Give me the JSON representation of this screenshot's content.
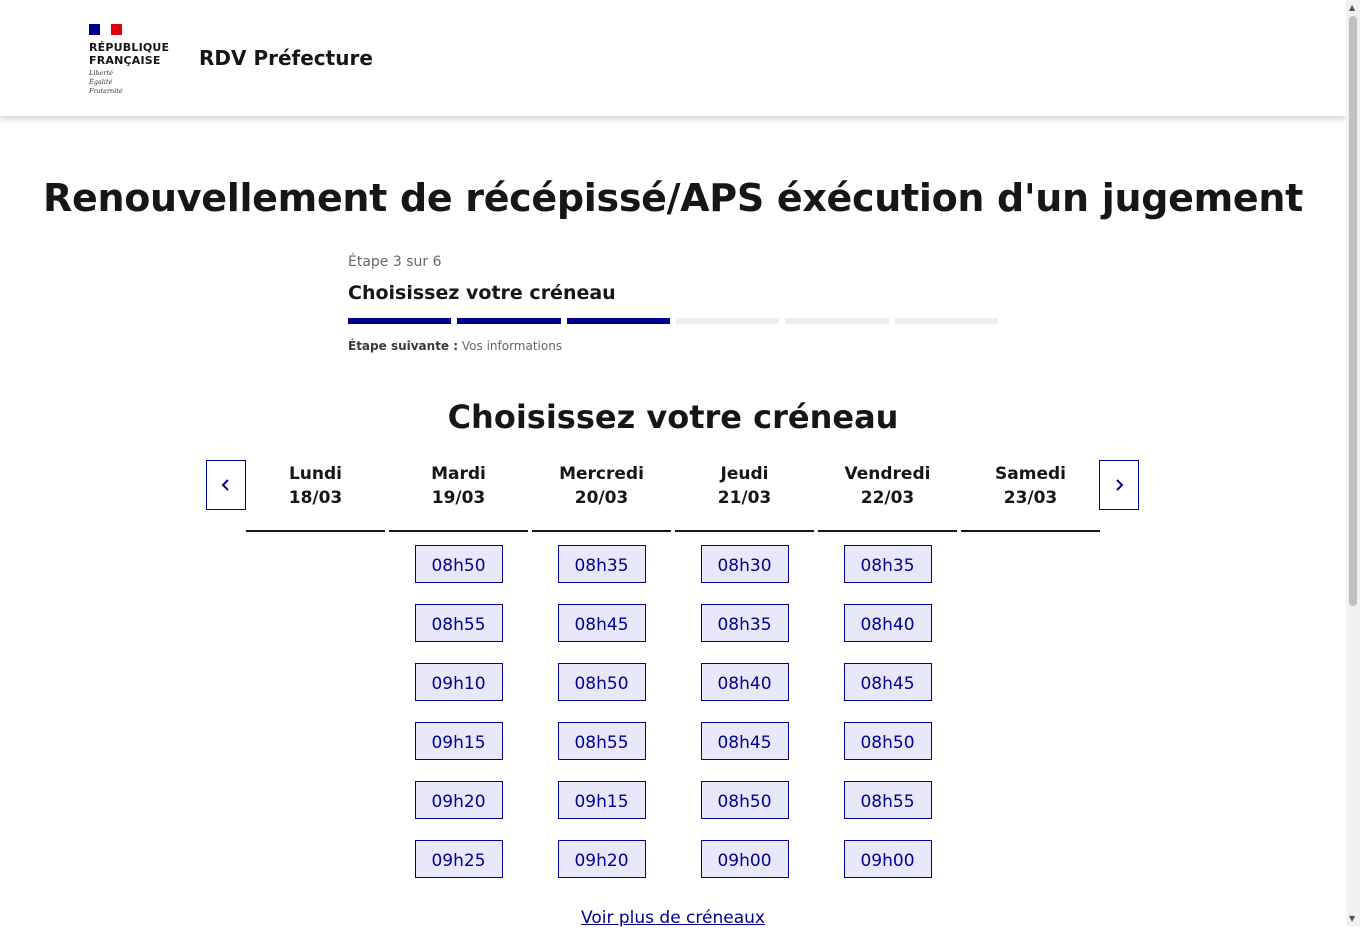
{
  "header": {
    "logo_text": "RÉPUBLIQUE\nFRANÇAISE",
    "logo_motto": "Liberté\nÉgalité\nFraternité",
    "flag_colors": [
      "#000091",
      "#ffffff",
      "#e1000f"
    ],
    "service_title": "RDV Préfecture"
  },
  "page": {
    "title": "Renouvellement de récépissé/APS éxécution d'un jugement"
  },
  "stepper": {
    "count": "Étape 3 sur 6",
    "title": "Choisissez votre créneau",
    "total_steps": 6,
    "completed_steps": 3,
    "next_label": "Étape suivante :",
    "next_value": "Vos informations"
  },
  "calendar": {
    "title": "Choisissez votre créneau",
    "prev_icon": "chevron-left-icon",
    "next_icon": "chevron-right-icon",
    "days": [
      {
        "name": "Lundi",
        "date": "18/03",
        "slots": []
      },
      {
        "name": "Mardi",
        "date": "19/03",
        "slots": [
          "08h50",
          "08h55",
          "09h10",
          "09h15",
          "09h20",
          "09h25"
        ]
      },
      {
        "name": "Mercredi",
        "date": "20/03",
        "slots": [
          "08h35",
          "08h45",
          "08h50",
          "08h55",
          "09h15",
          "09h20"
        ]
      },
      {
        "name": "Jeudi",
        "date": "21/03",
        "slots": [
          "08h30",
          "08h35",
          "08h40",
          "08h45",
          "08h50",
          "09h00"
        ]
      },
      {
        "name": "Vendredi",
        "date": "22/03",
        "slots": [
          "08h35",
          "08h40",
          "08h45",
          "08h50",
          "08h55",
          "09h00"
        ]
      },
      {
        "name": "Samedi",
        "date": "23/03",
        "slots": []
      }
    ],
    "more_link": "Voir plus de créneaux"
  },
  "colors": {
    "primary": "#000091",
    "slot_bg": "#e8e8fa",
    "inactive_step": "#eeeeee"
  }
}
